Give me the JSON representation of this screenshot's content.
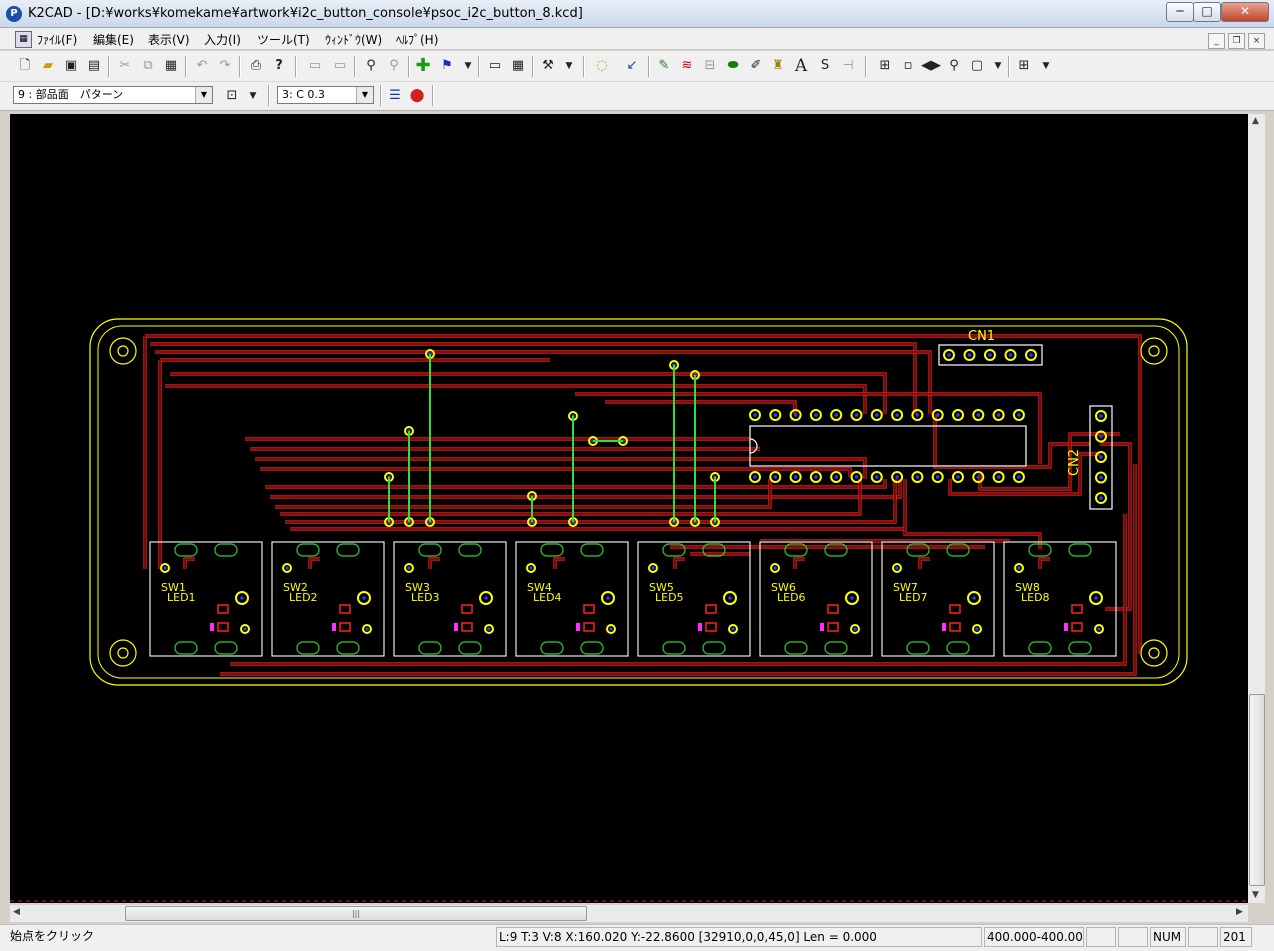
{
  "window": {
    "title": "K2CAD - [D:¥works¥komekame¥artwork¥i2c_button_console¥psoc_i2c_button_8.kcd]",
    "controls": {
      "minimize": "─",
      "maximize": "□",
      "close": "✕"
    }
  },
  "menu": {
    "items": [
      "ﾌｧｲﾙ(F)",
      "編集(E)",
      "表示(V)",
      "入力(I)",
      "ツール(T)",
      "ｳｨﾝﾄﾞｳ(W)",
      "ﾍﾙﾌﾟ(H)"
    ],
    "mdi_controls": {
      "minimize": "_",
      "restore": "❐",
      "close": "×"
    }
  },
  "toolbar": {
    "icons": [
      "new-icon",
      "open-icon",
      "save-icon",
      "save-all-icon",
      "cut-icon",
      "copy-icon",
      "paste-icon",
      "undo-icon",
      "redo-icon",
      "print-icon",
      "help-icon",
      "layer-up-icon",
      "layer-down-icon",
      "find-icon",
      "find-next-icon",
      "add-icon",
      "flag-icon",
      "view-icon",
      "grid-icon",
      "hammer-icon",
      "lasso-icon",
      "pointer-icon",
      "pen-icon",
      "via-icon",
      "bus-icon",
      "pad-icon",
      "brush-icon",
      "label-icon",
      "text-icon",
      "arc-icon",
      "pin-icon",
      "zoom-in-icon",
      "zoom-box-icon",
      "flip-icon",
      "zoom-icon",
      "window-icon",
      "grid-setting-icon"
    ]
  },
  "toolbar2": {
    "layer_select": "9 : 部品面　パターン",
    "line_select": "3: C 0.3",
    "icons": [
      "layer-props-icon",
      "line-style-icon",
      "color-icon"
    ]
  },
  "board": {
    "refdes": {
      "switches": [
        "SW1",
        "SW2",
        "SW3",
        "SW4",
        "SW5",
        "SW6",
        "SW7",
        "SW8"
      ],
      "leds": [
        "LED1",
        "LED2",
        "LED3",
        "LED4",
        "LED5",
        "LED6",
        "LED7",
        "LED8"
      ],
      "connectors": [
        "CN1",
        "CN2"
      ]
    },
    "colors": {
      "background": "#000000",
      "outline": "#ffff00",
      "trace": "#ff2020",
      "via_jumper": "#30e030",
      "silk": "#ffffff",
      "pad_ring": "#ffff00",
      "pad_core": "#2040ff",
      "resist_mark": "#ff30ff"
    }
  },
  "status": {
    "hint": "始点をクリック",
    "coords": "L:9 T:3 V:8 X:160.020 Y:-22.8600 [32910,0,0,45,0] Len = 0.000",
    "range": "400.000-400.000",
    "num": "NUM",
    "extra": "201"
  }
}
